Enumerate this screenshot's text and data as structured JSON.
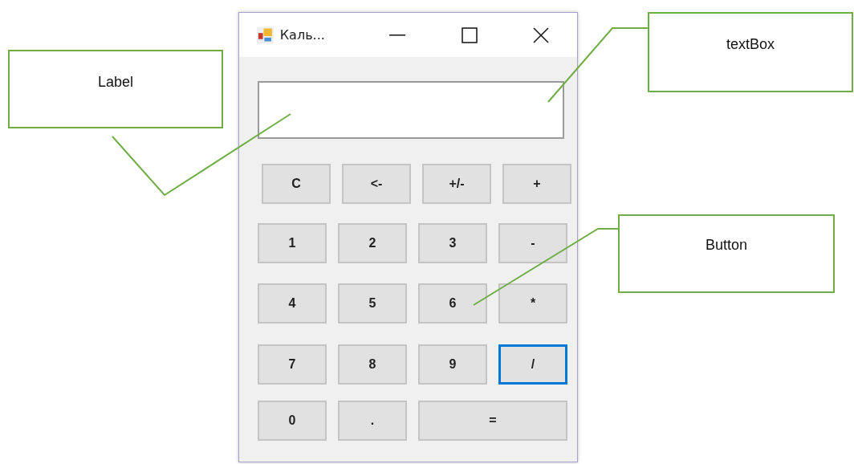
{
  "window": {
    "title": "Каль..."
  },
  "button_rows": [
    [
      {
        "label": "C",
        "kind": "normal",
        "focused": false
      },
      {
        "label": "<-",
        "kind": "normal",
        "focused": false
      },
      {
        "label": "+/-",
        "kind": "normal",
        "focused": false
      },
      {
        "label": "+",
        "kind": "normal",
        "focused": false
      }
    ],
    [
      {
        "label": "1",
        "kind": "normal",
        "focused": false
      },
      {
        "label": "2",
        "kind": "normal",
        "focused": false
      },
      {
        "label": "3",
        "kind": "normal",
        "focused": false
      },
      {
        "label": "-",
        "kind": "normal",
        "focused": false
      }
    ],
    [
      {
        "label": "4",
        "kind": "normal",
        "focused": false
      },
      {
        "label": "5",
        "kind": "normal",
        "focused": false
      },
      {
        "label": "6",
        "kind": "normal",
        "focused": false
      },
      {
        "label": "*",
        "kind": "normal",
        "focused": false
      }
    ],
    [
      {
        "label": "7",
        "kind": "normal",
        "focused": false
      },
      {
        "label": "8",
        "kind": "normal",
        "focused": false
      },
      {
        "label": "9",
        "kind": "normal",
        "focused": false
      },
      {
        "label": "/",
        "kind": "normal",
        "focused": true
      }
    ],
    [
      {
        "label": "0",
        "kind": "normal",
        "focused": false
      },
      {
        "label": ".",
        "kind": "normal",
        "focused": false
      },
      {
        "label": "=",
        "kind": "wide",
        "focused": false
      }
    ]
  ],
  "callouts": [
    {
      "text": "Label"
    },
    {
      "text": "textBox"
    },
    {
      "text": "Button"
    }
  ]
}
